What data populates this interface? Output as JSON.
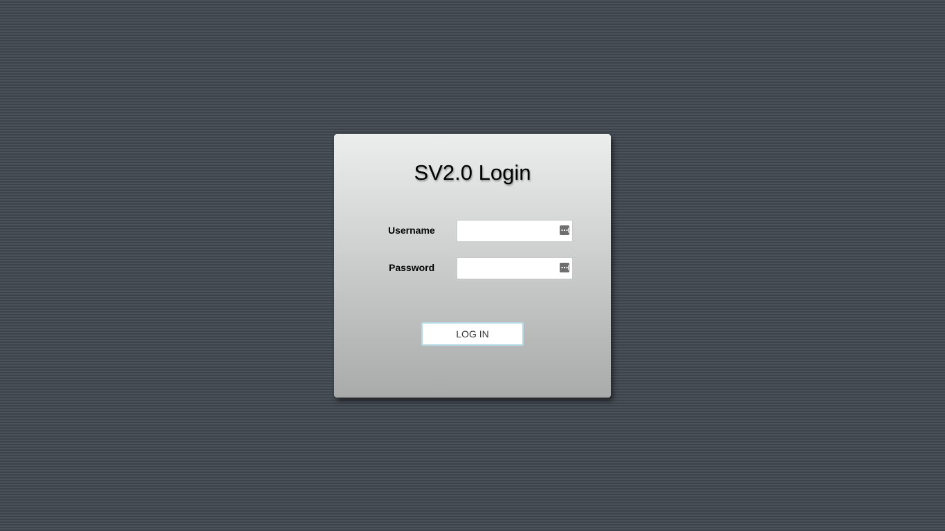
{
  "login": {
    "title": "SV2.0 Login",
    "username": {
      "label": "Username",
      "value": "",
      "placeholder": "",
      "icon": "password-manager-icon"
    },
    "password": {
      "label": "Password",
      "value": "",
      "placeholder": "",
      "icon": "password-manager-icon"
    },
    "submit_label": "LOG IN"
  },
  "colors": {
    "background": "#434a52",
    "panel_top": "#eceeee",
    "panel_bottom": "#a9aaaa",
    "button_border": "#b6dbe6"
  }
}
